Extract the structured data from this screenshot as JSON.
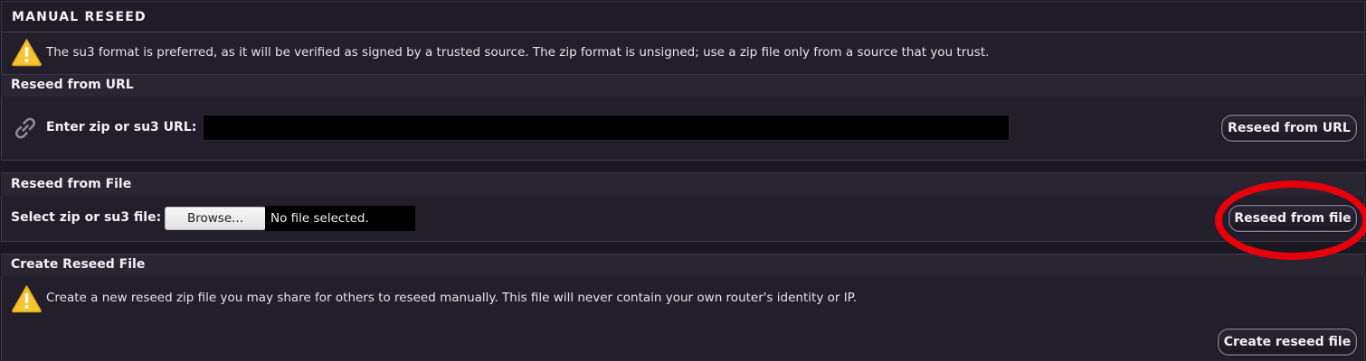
{
  "header": {
    "title": "MANUAL RESEED"
  },
  "notice_top": {
    "icon": "warning-icon",
    "text": "The su3 format is preferred, as it will be verified as signed by a trusted source.  The zip format is unsigned; use a zip file only from a source that you trust."
  },
  "url_section": {
    "title": "Reseed from URL",
    "icon": "link-icon",
    "label": "Enter zip or su3 URL:",
    "input_value": "",
    "button_label": "Reseed from URL"
  },
  "file_section": {
    "title": "Reseed from File",
    "label": "Select zip or su3 file:",
    "browse_label": "Browse...",
    "file_status": "No file selected.",
    "button_label": "Reseed from file"
  },
  "create_section": {
    "title": "Create Reseed File",
    "icon": "warning-icon",
    "text": "Create a new reseed zip file you may share for others to reseed manually.  This file will never contain your own router's identity or IP.",
    "button_label": "Create reseed file"
  },
  "colors": {
    "background": "#1b1822",
    "panel": "#221e2b",
    "highlight": "#e6000b",
    "warning": "#f6c02a"
  }
}
